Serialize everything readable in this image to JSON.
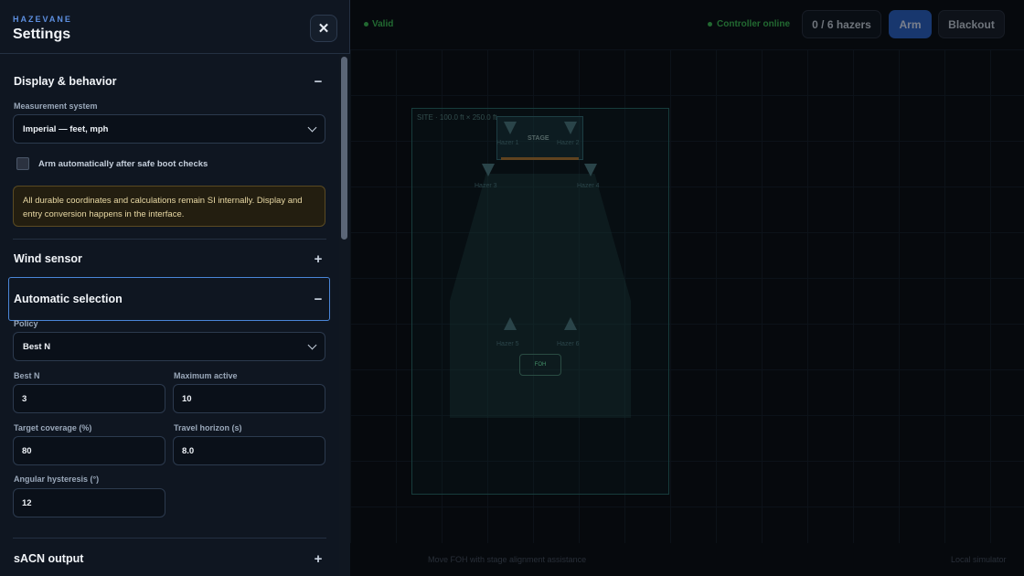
{
  "app": {
    "status_valid": "Valid",
    "controller_status": "Controller online",
    "hazer_count": "0 / 6 hazers",
    "arm_label": "Arm",
    "blackout_label": "Blackout",
    "site_label": "SITE · 100.0 ft × 250.0 ft",
    "stage_label": "STAGE",
    "fixture_label": "FOH",
    "hazers": [
      "Hazer 1",
      "Hazer 2",
      "Hazer 3",
      "Hazer 4",
      "Hazer 5",
      "Hazer 6"
    ],
    "footer_left": "Move FOH with stage alignment assistance",
    "footer_right": "Local simulator"
  },
  "settings": {
    "brand": "HAZEVANE",
    "title": "Settings",
    "close_icon": "close-icon",
    "display": {
      "title": "Display & behavior",
      "toggle": "−",
      "measurement_label": "Measurement system",
      "measurement_value": "Imperial — feet, mph",
      "auto_arm_label": "Arm automatically after safe boot checks",
      "auto_arm_checked": false,
      "note": "All durable coordinates and calculations remain SI internally. Display and entry conversion happens in the interface."
    },
    "wind": {
      "title": "Wind sensor",
      "toggle": "+"
    },
    "auto_select": {
      "title": "Automatic selection",
      "toggle": "−",
      "policy_label": "Policy",
      "policy_value": "Best N",
      "best_n_label": "Best N",
      "best_n_value": "3",
      "max_active_label": "Maximum active",
      "max_active_value": "10",
      "target_coverage_label": "Target coverage (%)",
      "target_coverage_value": "80",
      "travel_horizon_label": "Travel horizon (s)",
      "travel_horizon_value": "8.0",
      "angular_hysteresis_label": "Angular hysteresis (°)",
      "angular_hysteresis_value": "12"
    },
    "sacn": {
      "title": "sACN output",
      "toggle": "+"
    }
  }
}
